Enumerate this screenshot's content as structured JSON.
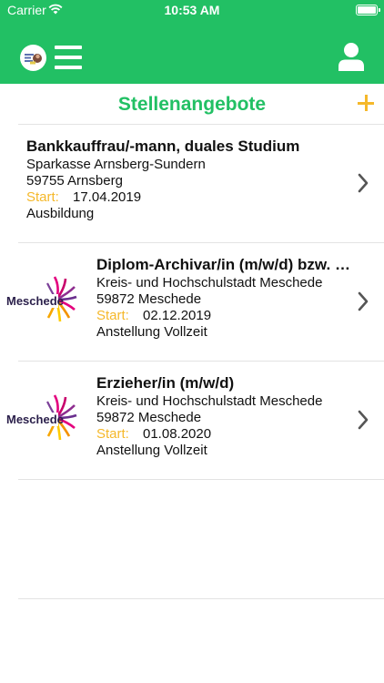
{
  "status_bar": {
    "carrier": "Carrier",
    "time": "10:53 AM",
    "battery_level": 1.0
  },
  "header": {
    "logo_icon": "app-logo-icon",
    "menu_icon": "hamburger-menu-icon",
    "profile_icon": "user-profile-icon"
  },
  "page": {
    "title": "Stellenangebote",
    "add_icon": "plus-icon"
  },
  "colors": {
    "brand_green": "#22c064",
    "accent_orange": "#f5b82a",
    "text": "#111111",
    "divider": "#e3e3e3",
    "chevron": "#555555"
  },
  "jobs": [
    {
      "title": "Bankkauffrau/-mann, duales Studium",
      "employer": "Sparkasse Arnsberg-Sundern",
      "location": "59755 Arnsberg",
      "start_label": "Start:",
      "start_date": "17.04.2019",
      "type": "Ausbildung",
      "logo": null
    },
    {
      "title": "Diplom-Archivar/in (m/w/d) bzw. F...",
      "employer": "Kreis- und Hochschulstadt Meschede",
      "location": "59872 Meschede",
      "start_label": "Start:",
      "start_date": "02.12.2019",
      "type": "Anstellung Vollzeit",
      "logo": "Meschede"
    },
    {
      "title": "Erzieher/in (m/w/d)",
      "employer": "Kreis- und Hochschulstadt Meschede",
      "location": "59872 Meschede",
      "start_label": "Start:",
      "start_date": "01.08.2020",
      "type": "Anstellung Vollzeit",
      "logo": "Meschede"
    }
  ]
}
